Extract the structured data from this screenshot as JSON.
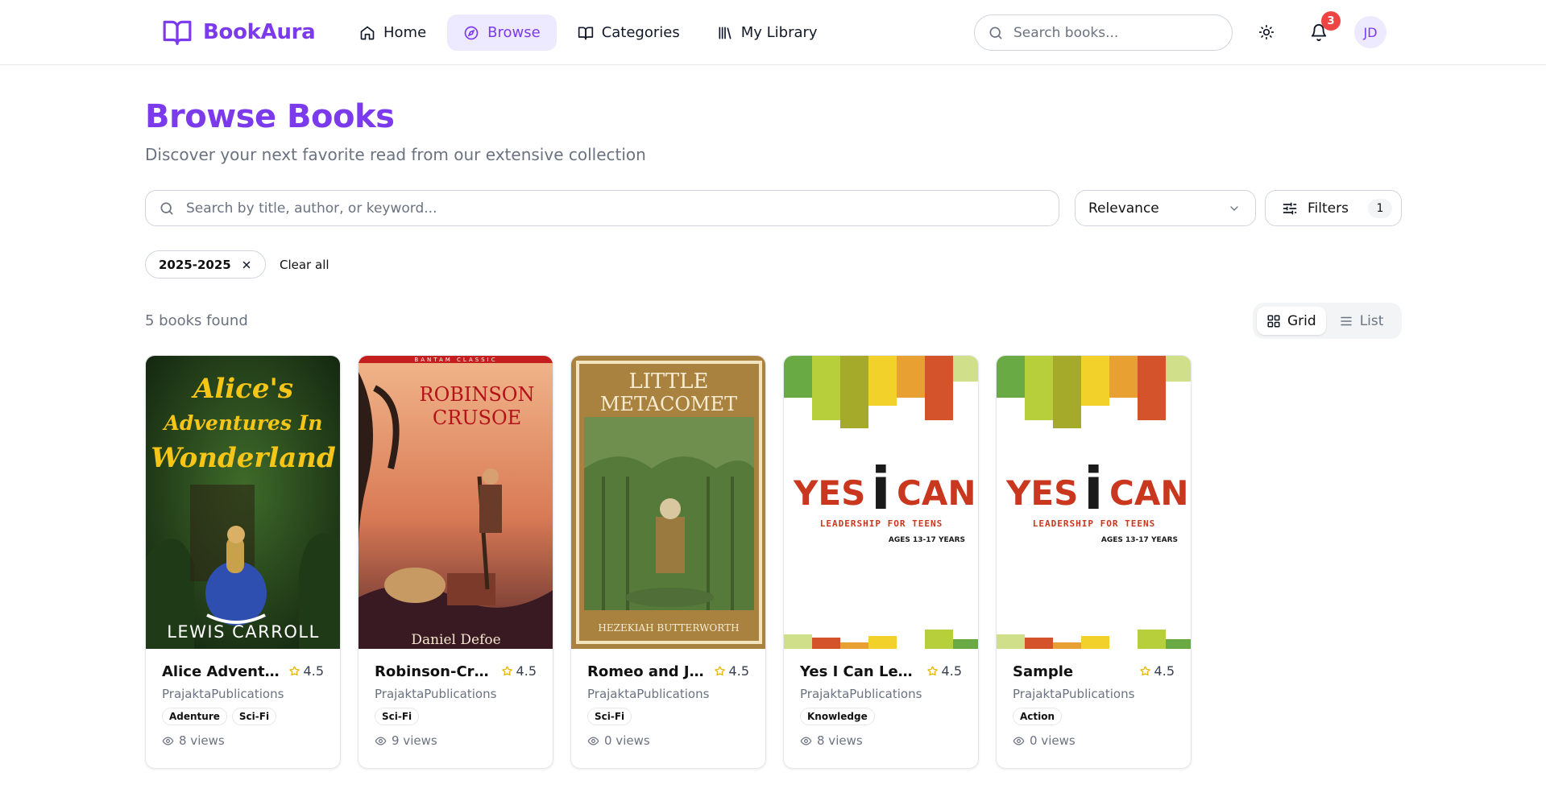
{
  "brand": {
    "name": "BookAura",
    "accent": "#7c3aed"
  },
  "nav": {
    "items": [
      {
        "label": "Home",
        "icon": "home-icon",
        "active": false
      },
      {
        "label": "Browse",
        "icon": "compass-icon",
        "active": true
      },
      {
        "label": "Categories",
        "icon": "book-open-icon",
        "active": false
      },
      {
        "label": "My Library",
        "icon": "library-icon",
        "active": false
      }
    ],
    "search_placeholder": "Search books...",
    "notification_count": "3",
    "avatar_initials": "JD"
  },
  "page": {
    "title": "Browse Books",
    "subtitle": "Discover your next favorite read from our extensive collection"
  },
  "toolbar": {
    "search_placeholder": "Search by title, author, or keyword...",
    "sort_value": "Relevance",
    "filters_label": "Filters",
    "filters_count": "1"
  },
  "active_filters": {
    "chips": [
      "2025-2025"
    ],
    "clear_label": "Clear all"
  },
  "results": {
    "count_text": "5 books found",
    "view_grid_label": "Grid",
    "view_list_label": "List",
    "active_view": "grid"
  },
  "books": [
    {
      "title": "Alice Adventures In Wonderland",
      "rating": "4.5",
      "publisher": "PrajaktaPublications",
      "tags": [
        "Adenture",
        "Sci-Fi"
      ],
      "views": "8 views",
      "cover": {
        "heading": [
          "Alice's",
          "Adventures In",
          "Wonderland"
        ],
        "author": "LEWIS CARROLL"
      }
    },
    {
      "title": "Robinson-Crusoe",
      "rating": "4.5",
      "publisher": "PrajaktaPublications",
      "tags": [
        "Sci-Fi"
      ],
      "views": "9 views",
      "cover": {
        "banner": "BANTAM CLASSIC",
        "heading": [
          "ROBINSON",
          "CRUSOE"
        ],
        "author": "Daniel Defoe"
      }
    },
    {
      "title": "Romeo and Juliet",
      "rating": "4.5",
      "publisher": "PrajaktaPublications",
      "tags": [
        "Sci-Fi"
      ],
      "views": "0 views",
      "cover": {
        "heading": [
          "LITTLE",
          "METACOMET"
        ],
        "author": "HEZEKIAH BUTTERWORTH"
      }
    },
    {
      "title": "Yes I Can Leadership",
      "rating": "4.5",
      "publisher": "PrajaktaPublications",
      "tags": [
        "Knowledge"
      ],
      "views": "8 views",
      "cover": {
        "heading_left": "YES",
        "heading_mid": "i",
        "heading_right": "CAN",
        "line1": "LEADERSHIP FOR TEENS",
        "line2": "AGES 13-17 YEARS"
      }
    },
    {
      "title": "Sample",
      "rating": "4.5",
      "publisher": "PrajaktaPublications",
      "tags": [
        "Action"
      ],
      "views": "0 views",
      "cover": {
        "heading_left": "YES",
        "heading_mid": "i",
        "heading_right": "CAN",
        "line1": "LEADERSHIP FOR TEENS",
        "line2": "AGES 13-17 YEARS"
      }
    }
  ]
}
